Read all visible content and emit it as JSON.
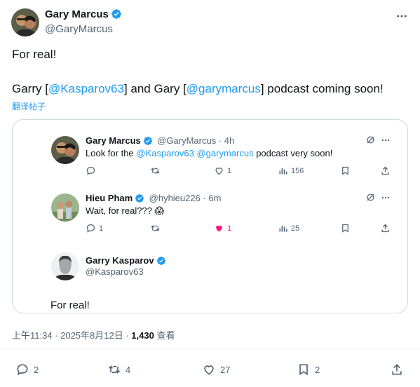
{
  "tweet": {
    "author_name": "Gary Marcus",
    "author_handle": "@GaryMarcus",
    "line1": "For real!",
    "line2_pre": "Garry [",
    "line2_mention1": "@Kasparov63",
    "line2_mid": "] and Gary [",
    "line2_mention2": "@garymarcus",
    "line2_post": "] podcast coming soon!",
    "translate": "翻译帖子",
    "timestamp": "上午11:34 · 2025年8月12日 · ",
    "views_count": "1,430",
    "views_label": " 查看",
    "replies": "2",
    "reposts": "4",
    "likes": "27",
    "bookmarks": "2"
  },
  "thread": [
    {
      "name": "Gary Marcus",
      "handle": "@GaryMarcus · 4h",
      "text_pre": "Look for the ",
      "mention1": "@Kasparov63",
      "space": " ",
      "mention2": "@garymarcus",
      "text_post": " podcast very soon!",
      "views": "156"
    },
    {
      "name": "Hieu Pham",
      "handle": "@hyhieu226 · 6m",
      "text": "Wait, for real??? 😱",
      "replies": "1",
      "likes": "1",
      "views": "25"
    },
    {
      "name": "Garry Kasparov",
      "handle": "@Kasparov63",
      "text": "For real!"
    }
  ],
  "colors": {
    "accent": "#1d9bf0",
    "text": "#0f1419",
    "muted": "#536471",
    "like": "#f91880",
    "border": "#cfd9de"
  }
}
